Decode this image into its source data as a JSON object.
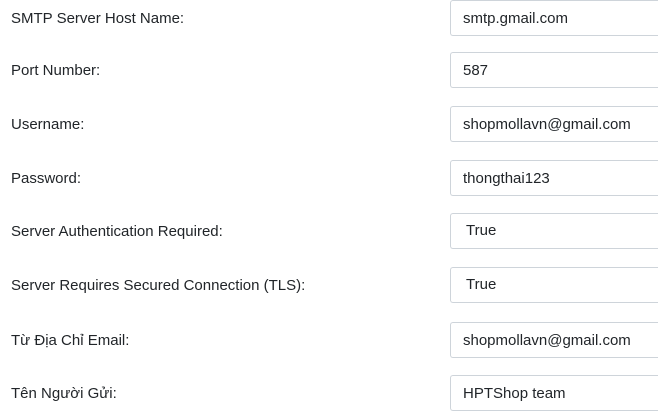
{
  "form": {
    "smtp_host": {
      "label": "SMTP Server Host Name:",
      "value": "smtp.gmail.com"
    },
    "port": {
      "label": "Port Number:",
      "value": "587"
    },
    "username": {
      "label": "Username:",
      "value": "shopmollavn@gmail.com"
    },
    "password": {
      "label": "Password:",
      "value": "thongthai123"
    },
    "auth_required": {
      "label": "Server Authentication Required:",
      "selected": "True"
    },
    "tls": {
      "label": "Server Requires Secured Connection (TLS):",
      "selected": "True"
    },
    "from_email": {
      "label": "Từ Địa Chỉ Email:",
      "value": "shopmollavn@gmail.com"
    },
    "sender_name": {
      "label": "Tên Người Gửi:",
      "value": "HPTShop team"
    }
  }
}
